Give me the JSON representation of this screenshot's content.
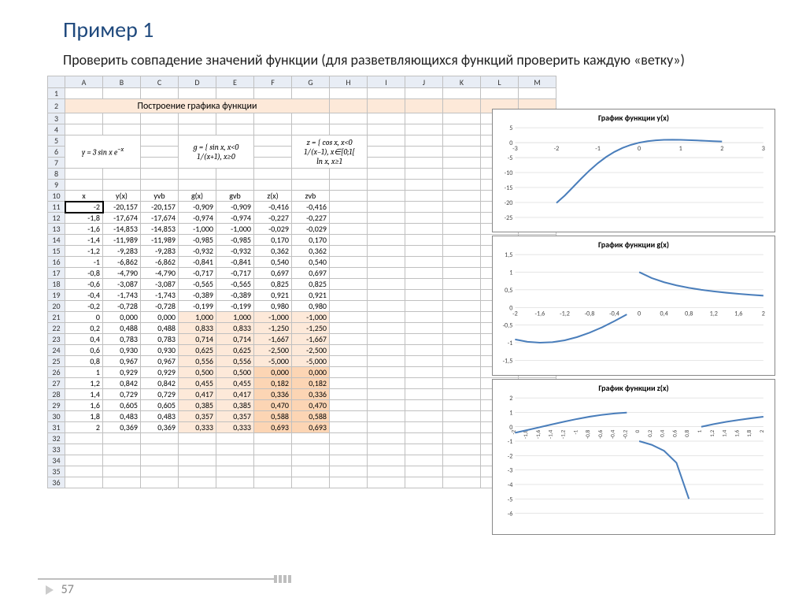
{
  "title": "Пример 1",
  "subtitle": "Проверить совпадение значений функции (для разветвляющихся функций проверить каждую «ветку»)",
  "page_number": "57",
  "spreadsheet": {
    "col_headers": [
      "A",
      "B",
      "C",
      "D",
      "E",
      "F",
      "G",
      "H",
      "I",
      "J",
      "K",
      "L",
      "M"
    ],
    "row_headers": [
      "1",
      "2",
      "3",
      "4",
      "5",
      "6",
      "7",
      "8",
      "9",
      "10",
      "11",
      "12",
      "13",
      "14",
      "15",
      "16",
      "17",
      "18",
      "19",
      "20",
      "21",
      "22",
      "23",
      "24",
      "25",
      "26",
      "27",
      "28",
      "29",
      "30",
      "31",
      "32",
      "33",
      "34",
      "35",
      "36"
    ],
    "section_title": "Построение графика функции",
    "formula_y": "y = 3 sin x e^{-x}",
    "formula_g": "g = { sin x, x < 0 ; 1/(x+1), x ≥ 0 }",
    "formula_z": "z = { cos x, x < 0 ; 1/(x−1), x ∈ [0;1[ ; ln x, x ≥ 1 }",
    "data_headers": [
      "x",
      "y(x)",
      "yvb",
      "g(x)",
      "gvb",
      "z(x)",
      "zvb"
    ],
    "selected_cell": "A11",
    "rows": [
      {
        "v": [
          "-2",
          "-20,157",
          "-20,157",
          "-0,909",
          "-0,909",
          "-0,416",
          "-0,416"
        ],
        "hl": [
          0,
          0,
          0,
          0,
          0,
          0,
          0
        ]
      },
      {
        "v": [
          "-1,8",
          "-17,674",
          "-17,674",
          "-0,974",
          "-0,974",
          "-0,227",
          "-0,227"
        ],
        "hl": [
          0,
          0,
          0,
          0,
          0,
          0,
          0
        ]
      },
      {
        "v": [
          "-1,6",
          "-14,853",
          "-14,853",
          "-1,000",
          "-1,000",
          "-0,029",
          "-0,029"
        ],
        "hl": [
          0,
          0,
          0,
          0,
          0,
          0,
          0
        ]
      },
      {
        "v": [
          "-1,4",
          "-11,989",
          "-11,989",
          "-0,985",
          "-0,985",
          "0,170",
          "0,170"
        ],
        "hl": [
          0,
          0,
          0,
          0,
          0,
          0,
          0
        ]
      },
      {
        "v": [
          "-1,2",
          "-9,283",
          "-9,283",
          "-0,932",
          "-0,932",
          "0,362",
          "0,362"
        ],
        "hl": [
          0,
          0,
          0,
          0,
          0,
          0,
          0
        ]
      },
      {
        "v": [
          "-1",
          "-6,862",
          "-6,862",
          "-0,841",
          "-0,841",
          "0,540",
          "0,540"
        ],
        "hl": [
          0,
          0,
          0,
          0,
          0,
          0,
          0
        ]
      },
      {
        "v": [
          "-0,8",
          "-4,790",
          "-4,790",
          "-0,717",
          "-0,717",
          "0,697",
          "0,697"
        ],
        "hl": [
          0,
          0,
          0,
          0,
          0,
          0,
          0
        ]
      },
      {
        "v": [
          "-0,6",
          "-3,087",
          "-3,087",
          "-0,565",
          "-0,565",
          "0,825",
          "0,825"
        ],
        "hl": [
          0,
          0,
          0,
          0,
          0,
          0,
          0
        ]
      },
      {
        "v": [
          "-0,4",
          "-1,743",
          "-1,743",
          "-0,389",
          "-0,389",
          "0,921",
          "0,921"
        ],
        "hl": [
          0,
          0,
          0,
          0,
          0,
          0,
          0
        ]
      },
      {
        "v": [
          "-0,2",
          "-0,728",
          "-0,728",
          "-0,199",
          "-0,199",
          "0,980",
          "0,980"
        ],
        "hl": [
          0,
          0,
          0,
          0,
          0,
          0,
          0
        ]
      },
      {
        "v": [
          "0",
          "0,000",
          "0,000",
          "1,000",
          "1,000",
          "-1,000",
          "-1,000"
        ],
        "hl": [
          0,
          0,
          0,
          1,
          1,
          1,
          1
        ]
      },
      {
        "v": [
          "0,2",
          "0,488",
          "0,488",
          "0,833",
          "0,833",
          "-1,250",
          "-1,250"
        ],
        "hl": [
          0,
          0,
          0,
          1,
          1,
          1,
          1
        ]
      },
      {
        "v": [
          "0,4",
          "0,783",
          "0,783",
          "0,714",
          "0,714",
          "-1,667",
          "-1,667"
        ],
        "hl": [
          0,
          0,
          0,
          1,
          1,
          1,
          1
        ]
      },
      {
        "v": [
          "0,6",
          "0,930",
          "0,930",
          "0,625",
          "0,625",
          "-2,500",
          "-2,500"
        ],
        "hl": [
          0,
          0,
          0,
          1,
          1,
          1,
          1
        ]
      },
      {
        "v": [
          "0,8",
          "0,967",
          "0,967",
          "0,556",
          "0,556",
          "-5,000",
          "-5,000"
        ],
        "hl": [
          0,
          0,
          0,
          1,
          1,
          1,
          1
        ]
      },
      {
        "v": [
          "1",
          "0,929",
          "0,929",
          "0,500",
          "0,500",
          "0,000",
          "0,000"
        ],
        "hl": [
          0,
          0,
          0,
          1,
          1,
          2,
          2
        ]
      },
      {
        "v": [
          "1,2",
          "0,842",
          "0,842",
          "0,455",
          "0,455",
          "0,182",
          "0,182"
        ],
        "hl": [
          0,
          0,
          0,
          1,
          1,
          2,
          2
        ]
      },
      {
        "v": [
          "1,4",
          "0,729",
          "0,729",
          "0,417",
          "0,417",
          "0,336",
          "0,336"
        ],
        "hl": [
          0,
          0,
          0,
          1,
          1,
          2,
          2
        ]
      },
      {
        "v": [
          "1,6",
          "0,605",
          "0,605",
          "0,385",
          "0,385",
          "0,470",
          "0,470"
        ],
        "hl": [
          0,
          0,
          0,
          1,
          1,
          2,
          2
        ]
      },
      {
        "v": [
          "1,8",
          "0,483",
          "0,483",
          "0,357",
          "0,357",
          "0,588",
          "0,588"
        ],
        "hl": [
          0,
          0,
          0,
          1,
          1,
          2,
          2
        ]
      },
      {
        "v": [
          "2",
          "0,369",
          "0,369",
          "0,333",
          "0,333",
          "0,693",
          "0,693"
        ],
        "hl": [
          0,
          0,
          0,
          1,
          1,
          2,
          2
        ]
      }
    ]
  },
  "chart_data": [
    {
      "type": "line",
      "title": "График функции y(x)",
      "xlabel": "",
      "ylabel": "",
      "xlim": [
        -3,
        3
      ],
      "ylim": [
        -25,
        5
      ],
      "x_ticks": [
        -3,
        -2,
        -1,
        0,
        1,
        2,
        3
      ],
      "y_ticks": [
        5,
        0,
        -5,
        -10,
        -15,
        -20,
        -25
      ],
      "series": [
        {
          "name": "y(x)",
          "x": [
            -2,
            -1.8,
            -1.6,
            -1.4,
            -1.2,
            -1,
            -0.8,
            -0.6,
            -0.4,
            -0.2,
            0,
            0.2,
            0.4,
            0.6,
            0.8,
            1,
            1.2,
            1.4,
            1.6,
            1.8,
            2
          ],
          "y": [
            -20.157,
            -17.674,
            -14.853,
            -11.989,
            -9.283,
            -6.862,
            -4.79,
            -3.087,
            -1.743,
            -0.728,
            0,
            0.488,
            0.783,
            0.93,
            0.967,
            0.929,
            0.842,
            0.729,
            0.605,
            0.483,
            0.369
          ]
        }
      ],
      "color": "#4a7ebb"
    },
    {
      "type": "line",
      "title": "График функции g(x)",
      "xlabel": "",
      "ylabel": "",
      "xlim": [
        -2,
        2
      ],
      "ylim": [
        -1.5,
        1.5
      ],
      "x_ticks": [
        -2,
        -1.6,
        -1.2,
        -0.8,
        -0.4,
        0,
        0.4,
        0.8,
        1.2,
        1.6,
        2
      ],
      "y_ticks": [
        1.5,
        1,
        0.5,
        0,
        -0.5,
        -1,
        -1.5
      ],
      "series": [
        {
          "name": "g(x)",
          "x": [
            -2,
            -1.8,
            -1.6,
            -1.4,
            -1.2,
            -1,
            -0.8,
            -0.6,
            -0.4,
            -0.2,
            0,
            0.2,
            0.4,
            0.6,
            0.8,
            1,
            1.2,
            1.4,
            1.6,
            1.8,
            2
          ],
          "y": [
            -0.909,
            -0.974,
            -1.0,
            -0.985,
            -0.932,
            -0.841,
            -0.717,
            -0.565,
            -0.389,
            -0.199,
            1.0,
            0.833,
            0.714,
            0.625,
            0.556,
            0.5,
            0.455,
            0.417,
            0.385,
            0.357,
            0.333
          ]
        }
      ],
      "break_at": [
        9
      ],
      "color": "#4a7ebb"
    },
    {
      "type": "line",
      "title": "График функции z(x)",
      "xlabel": "",
      "ylabel": "",
      "xlim": [
        -2,
        2
      ],
      "ylim": [
        -6,
        2
      ],
      "x_ticks": [
        -2,
        -1.8,
        -1.6,
        -1.4,
        -1.2,
        -1,
        -0.8,
        -0.6,
        -0.4,
        -0.2,
        0,
        0.2,
        0.4,
        0.6,
        0.8,
        1,
        1.2,
        1.4,
        1.6,
        1.8,
        2
      ],
      "y_ticks": [
        2,
        1,
        0,
        -1,
        -2,
        -3,
        -4,
        -5,
        -6
      ],
      "series": [
        {
          "name": "z(x)",
          "x": [
            -2,
            -1.8,
            -1.6,
            -1.4,
            -1.2,
            -1,
            -0.8,
            -0.6,
            -0.4,
            -0.2,
            0,
            0.2,
            0.4,
            0.6,
            0.8,
            1,
            1.2,
            1.4,
            1.6,
            1.8,
            2
          ],
          "y": [
            -0.416,
            -0.227,
            -0.029,
            0.17,
            0.362,
            0.54,
            0.697,
            0.825,
            0.921,
            0.98,
            -1.0,
            -1.25,
            -1.667,
            -2.5,
            -5.0,
            0.0,
            0.182,
            0.336,
            0.47,
            0.588,
            0.693
          ]
        }
      ],
      "break_at": [
        9,
        14
      ],
      "color": "#4a7ebb",
      "rotate_x_labels": true
    }
  ]
}
